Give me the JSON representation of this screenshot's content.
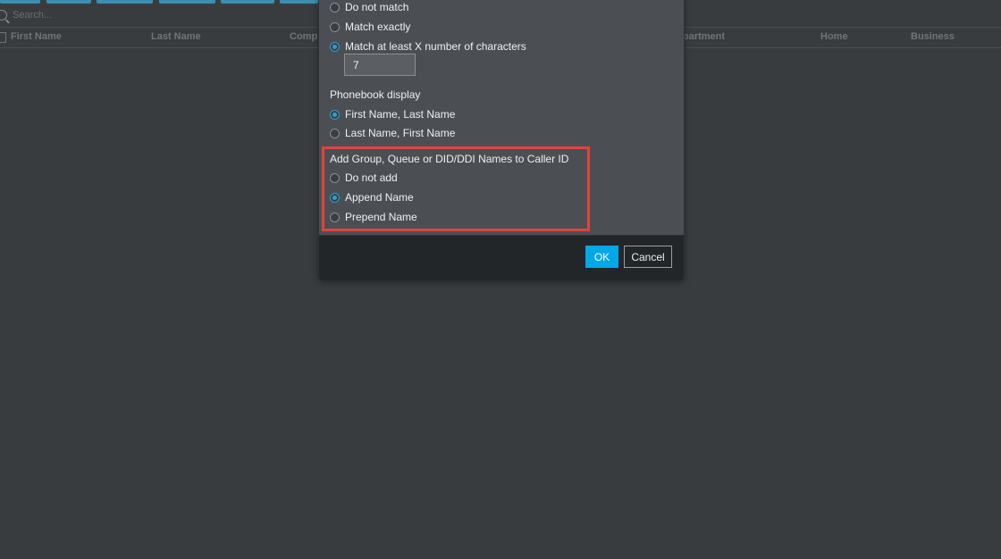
{
  "background": {
    "search": {
      "placeholder": "Search..."
    },
    "columns": [
      "First Name",
      "Last Name",
      "Comp",
      "partment",
      "Home",
      "Business"
    ]
  },
  "dialog": {
    "match_options": [
      {
        "label": "Do not match",
        "selected": false
      },
      {
        "label": "Match exactly",
        "selected": false
      },
      {
        "label": "Match at least X number of characters",
        "selected": true
      }
    ],
    "match_chars_value": "7",
    "phonebook_display": {
      "label": "Phonebook display",
      "options": [
        {
          "label": "First Name, Last Name",
          "selected": true
        },
        {
          "label": "Last Name, First Name",
          "selected": false
        }
      ]
    },
    "caller_id_names": {
      "label": "Add Group, Queue or DID/DDI Names to Caller ID",
      "options": [
        {
          "label": "Do not add",
          "selected": false
        },
        {
          "label": "Append Name",
          "selected": true
        },
        {
          "label": "Prepend Name",
          "selected": false
        }
      ]
    },
    "ok_label": "OK",
    "cancel_label": "Cancel",
    "accent_color": "#00a8e8",
    "highlight_color": "#e0443a"
  }
}
